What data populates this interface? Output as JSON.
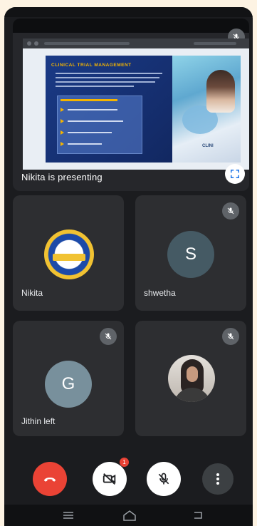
{
  "presentation": {
    "label": "Nikita is presenting",
    "slide_title": "CLINICAL TRIAL MANAGEMENT"
  },
  "participants": [
    {
      "name": "Nikita",
      "avatar": "logo",
      "muted": false
    },
    {
      "name": "shwetha",
      "avatar_initial": "S",
      "avatar_color": "#455a64",
      "muted": true
    },
    {
      "name": "Jithin left",
      "avatar_initial": "G",
      "avatar_color": "#78909c",
      "muted": true
    },
    {
      "name": "",
      "avatar": "photo",
      "muted": true
    }
  ],
  "controls": {
    "end_call_color": "#ea4335",
    "camera_badge_count": "1"
  },
  "icons": [
    "mic-off-icon",
    "fullscreen-icon",
    "phone-hangup-icon",
    "video-off-icon",
    "more-vertical-icon",
    "menu-icon",
    "home-icon",
    "back-icon"
  ]
}
